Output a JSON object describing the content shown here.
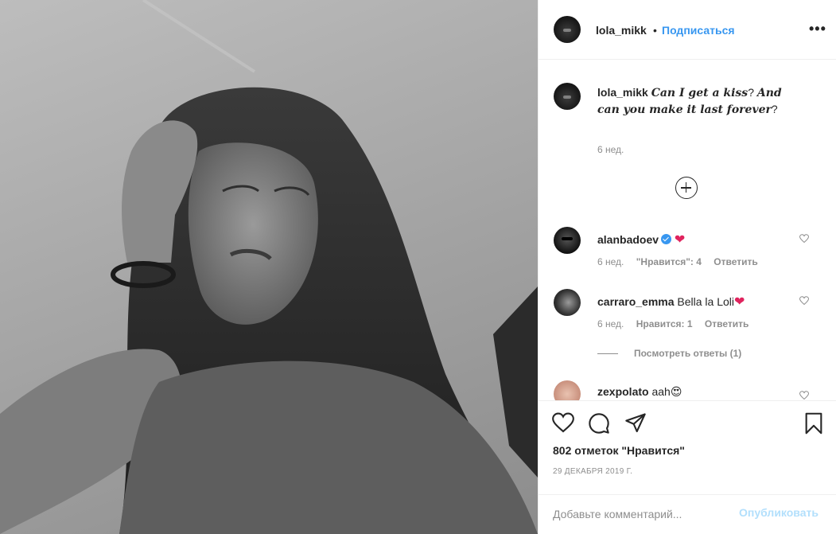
{
  "header": {
    "username": "lola_mikk",
    "separator": "•",
    "follow_label": "Подписаться",
    "more_label": "•••"
  },
  "caption": {
    "username": "lola_mikk",
    "text_1": "Can I get a kiss",
    "q1": "?",
    "text_2": "And can you make it last forever",
    "q2": "?",
    "time": "6 нед."
  },
  "comments": [
    {
      "username": "alanbadoev",
      "verified": true,
      "text": "",
      "emoji": "❤",
      "time": "6 нед.",
      "likes": "\"Нравится\": 4",
      "reply": "Ответить"
    },
    {
      "username": "carraro_emma",
      "verified": false,
      "text": "Bella la Loli",
      "emoji": "❤",
      "time": "6 нед.",
      "likes": "Нравится: 1",
      "reply": "Ответить"
    },
    {
      "username": "zexpolato",
      "verified": false,
      "text": "aah",
      "emoji": "😍",
      "time": "",
      "likes": "",
      "reply": ""
    }
  ],
  "view_replies": "Посмотреть ответы (1)",
  "likes_count": "802 отметок \"Нравится\"",
  "post_date": "29 ДЕКАБРЯ 2019 Г.",
  "add_comment": {
    "placeholder": "Добавьте комментарий...",
    "publish_label": "Опубликовать"
  },
  "colors": {
    "accent": "#3897f0",
    "publish_disabled": "#b2dffc",
    "secondary_text": "#8e8e8e",
    "heart": "#e0245e"
  },
  "icons": [
    "heart-icon",
    "comment-icon",
    "share-icon",
    "bookmark-icon",
    "add-comments-icon",
    "more-icon",
    "verified-icon"
  ]
}
